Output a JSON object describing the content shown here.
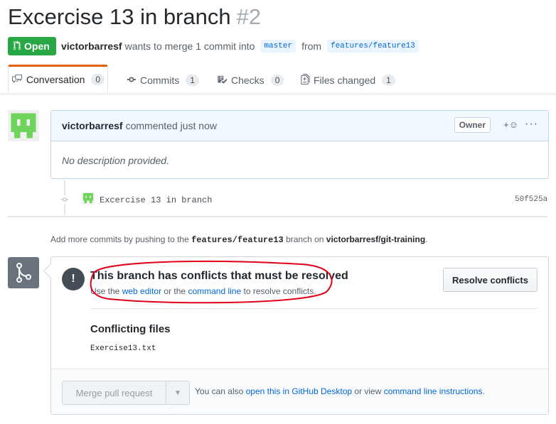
{
  "pr": {
    "title": "Excercise 13 in branch",
    "number": "#2",
    "state": "Open",
    "author": "victorbarresf",
    "summary": "wants to merge 1 commit into",
    "base_branch": "master",
    "from_word": "from",
    "head_branch": "features/feature13"
  },
  "tabs": [
    {
      "label": "Conversation",
      "count": "0",
      "icon": "comment-discussion-icon"
    },
    {
      "label": "Commits",
      "count": "1",
      "icon": "git-commit-icon"
    },
    {
      "label": "Checks",
      "count": "0",
      "icon": "checklist-icon"
    },
    {
      "label": "Files changed",
      "count": "1",
      "icon": "file-diff-icon"
    }
  ],
  "comment": {
    "author": "victorbarresf",
    "action": "commented just now",
    "role": "Owner",
    "reaction_icon": "+☺",
    "more_icon": "···",
    "body": "No description provided."
  },
  "commit": {
    "message": "Excercise 13 in branch",
    "sha": "50f525a"
  },
  "push_hint": {
    "prefix": "Add more commits by pushing to the",
    "branch": "features/feature13",
    "middle": "branch on",
    "repo": "victorbarresf/git-training",
    "suffix": "."
  },
  "merge": {
    "conflict_title": "This branch has conflicts that must be resolved",
    "desc_prefix": "Use the",
    "web_editor": "web editor",
    "desc_or": "or the",
    "command_line": "command line",
    "desc_suffix": "to resolve conflicts.",
    "resolve_button": "Resolve conflicts",
    "conflicting_files_label": "Conflicting files",
    "files": [
      "Exercise13.txt"
    ],
    "merge_button": "Merge pull request",
    "hint_prefix": "You can also",
    "open_desktop": "open this in GitHub Desktop",
    "hint_or": "or view",
    "cli_instructions": "command line instructions",
    "hint_suffix": "."
  },
  "colors": {
    "open_green": "#28a745",
    "link_blue": "#0366d6",
    "annotation_red": "#e0001a"
  }
}
